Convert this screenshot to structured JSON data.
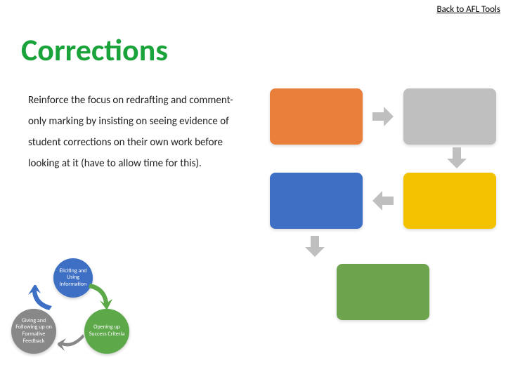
{
  "nav": {
    "back_link": "Back to AFL Tools"
  },
  "title": "Corrections",
  "body_text": "Reinforce the focus on redrafting and comment-only marking by insisting on seeing evidence of student corrections on their own work before looking at it (have to allow time for this).",
  "flow": {
    "boxes": [
      {
        "id": "orange",
        "color": "#e97f3b"
      },
      {
        "id": "grey",
        "color": "#bfbfbf"
      },
      {
        "id": "blue",
        "color": "#3d6fc4"
      },
      {
        "id": "yellow",
        "color": "#f2c200"
      },
      {
        "id": "green",
        "color": "#6ea34e"
      }
    ],
    "arrow_color": "#bfbfbf"
  },
  "cycle": {
    "nodes": [
      {
        "id": "eliciting",
        "label": "Eliciting and Using Information",
        "color": "#3d6fc4"
      },
      {
        "id": "opening",
        "label": "Opening up Success Criteria",
        "color": "#5da94a"
      },
      {
        "id": "feedback",
        "label": "Giving and Following up on Formative Feedback",
        "color": "#888888"
      }
    ]
  }
}
